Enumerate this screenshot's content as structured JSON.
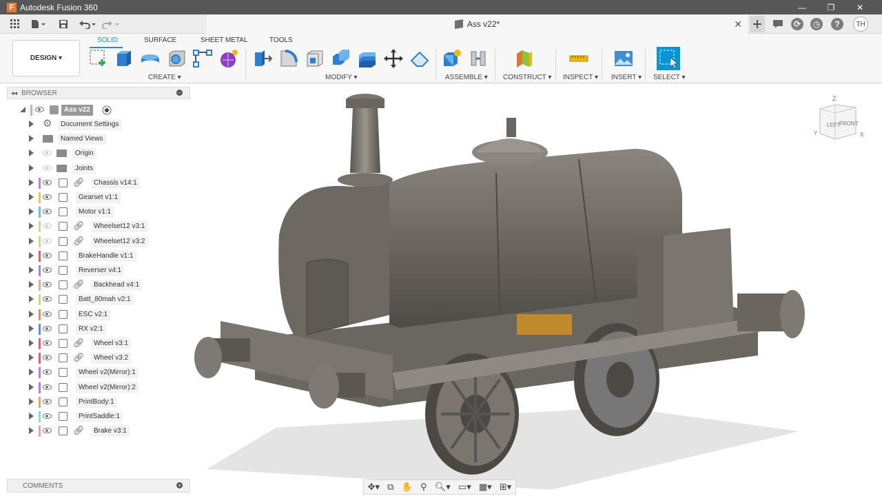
{
  "window": {
    "app_title": "Autodesk Fusion 360",
    "logo_letter": "F",
    "minimize": "—",
    "maximize": "❐",
    "close": "✕"
  },
  "doc_tab": {
    "title": "Ass v22*",
    "close": "✕"
  },
  "user": {
    "initials": "TH"
  },
  "ribbon": {
    "workspace": "DESIGN ▾",
    "tabs": [
      "SOLID",
      "SURFACE",
      "SHEET METAL",
      "TOOLS"
    ],
    "active_tab": "SOLID",
    "groups": [
      "CREATE ▾",
      "MODIFY ▾",
      "ASSEMBLE ▾",
      "CONSTRUCT ▾",
      "INSPECT ▾",
      "INSERT ▾",
      "SELECT ▾"
    ]
  },
  "browser": {
    "title": "BROWSER",
    "root": "Ass v22",
    "items": [
      {
        "label": "Document Settings",
        "icon": "gear-icon",
        "color": ""
      },
      {
        "label": "Named Views",
        "icon": "folder-icon",
        "color": ""
      },
      {
        "label": "Origin",
        "icon": "folder-icon",
        "color": ""
      },
      {
        "label": "Joints",
        "icon": "folder-icon",
        "color": ""
      },
      {
        "label": "Chassis v14:1",
        "icon": "component-icon",
        "color": "#c77dd4",
        "link": true
      },
      {
        "label": "Gearset v1:1",
        "icon": "component-icon",
        "color": "#f2c55b"
      },
      {
        "label": "Motor v1:1",
        "icon": "component-icon",
        "color": "#63c7d6"
      },
      {
        "label": "Wheelset12 v3:1",
        "icon": "component-icon",
        "color": "#c6e07a",
        "link": true
      },
      {
        "label": "Wheelset12 v3:2",
        "icon": "component-icon",
        "color": "#c6e07a",
        "link": true
      },
      {
        "label": "BrakeHandle v1:1",
        "icon": "component-icon",
        "color": "#e65a6b"
      },
      {
        "label": "Reverser v4:1",
        "icon": "component-icon",
        "color": "#b07ee0"
      },
      {
        "label": "Backhead v4:1",
        "icon": "component-icon",
        "color": "#f2a0a8",
        "link": true
      },
      {
        "label": "Batt_80mah v2:1",
        "icon": "component-icon",
        "color": "#c6e07a"
      },
      {
        "label": "ESC v2:1",
        "icon": "component-icon",
        "color": "#f08a4b"
      },
      {
        "label": "RX v2:1",
        "icon": "component-icon",
        "color": "#5a8ee0"
      },
      {
        "label": "Wheel v3:1",
        "icon": "component-icon",
        "color": "#e65a6b",
        "link": true
      },
      {
        "label": "Wheel v3:2",
        "icon": "component-icon",
        "color": "#e65a6b",
        "link": true
      },
      {
        "label": "Wheel v2(Mirror):1",
        "icon": "component-icon",
        "color": "#b07ee0"
      },
      {
        "label": "Wheel v2(Mirror):2",
        "icon": "component-icon",
        "color": "#b07ee0"
      },
      {
        "label": "PrintBody:1",
        "icon": "body-component-icon",
        "color": "#f2a54b"
      },
      {
        "label": "PrintSaddle:1",
        "icon": "body-component-icon",
        "color": "#7fe0d0"
      },
      {
        "label": "Brake v3:1",
        "icon": "component-icon",
        "color": "#f2a0a8",
        "link": true
      }
    ]
  },
  "comments": {
    "title": "COMMENTS"
  },
  "viewcube": {
    "top": "Z",
    "left": "LEFT",
    "front": "FRONT",
    "x": "X",
    "y": "Y"
  },
  "colors": {
    "accent": "#0696d7",
    "model": "#6f6a64"
  }
}
